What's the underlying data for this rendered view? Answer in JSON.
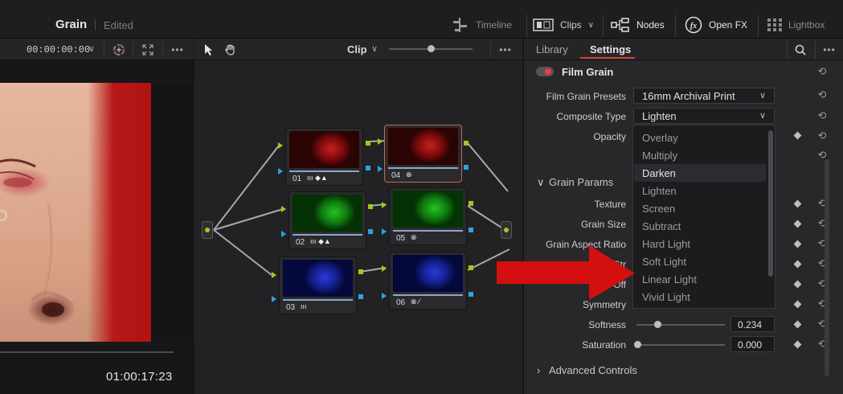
{
  "header": {
    "project_title": "Grain",
    "project_status": "Edited",
    "toolbar": {
      "timeline": "Timeline",
      "clips": "Clips",
      "nodes": "Nodes",
      "open_fx": "Open FX",
      "lightbox": "Lightbox"
    }
  },
  "viewer": {
    "timecode": "00:00:00:00",
    "current_timecode": "01:00:17:23"
  },
  "node_editor": {
    "mode_label": "Clip",
    "zoom_level": 0.55,
    "nodes": [
      {
        "number": "01",
        "color": "#d41414",
        "icons": "ııı ◆▲"
      },
      {
        "number": "02",
        "color": "#18b218",
        "icons": "ııı ◆▲"
      },
      {
        "number": "03",
        "color": "#1a2ccc",
        "icons": "ııı"
      },
      {
        "number": "04",
        "color": "#d41414",
        "icons": "⊗"
      },
      {
        "number": "05",
        "color": "#18b218",
        "icons": "⊗"
      },
      {
        "number": "06",
        "color": "#1a2ccc",
        "icons": "⊗ ⁄"
      }
    ]
  },
  "settings": {
    "tabs": [
      "Library",
      "Settings"
    ],
    "active_tab": "Settings",
    "effect_name": "Film Grain",
    "effect_enabled": true,
    "film_grain_presets": {
      "label": "Film Grain Presets",
      "value": "16mm Archival Print"
    },
    "composite_type": {
      "label": "Composite Type",
      "value": "Lighten",
      "options": [
        "Overlay",
        "Multiply",
        "Darken",
        "Lighten",
        "Screen",
        "Subtract",
        "Hard Light",
        "Soft Light",
        "Linear Light",
        "Vivid Light"
      ],
      "highlighted": "Darken"
    },
    "opacity_label": "Opacity",
    "grain_params": {
      "header": "Grain Params",
      "labels": [
        "Texture",
        "Grain Size",
        "Grain Aspect Ratio",
        "Grain Str",
        "Off",
        "Symmetry"
      ],
      "softness": {
        "label": "Softness",
        "value": "0.234"
      },
      "saturation": {
        "label": "Saturation",
        "value": "0.000"
      }
    },
    "advanced_controls": "Advanced Controls"
  }
}
